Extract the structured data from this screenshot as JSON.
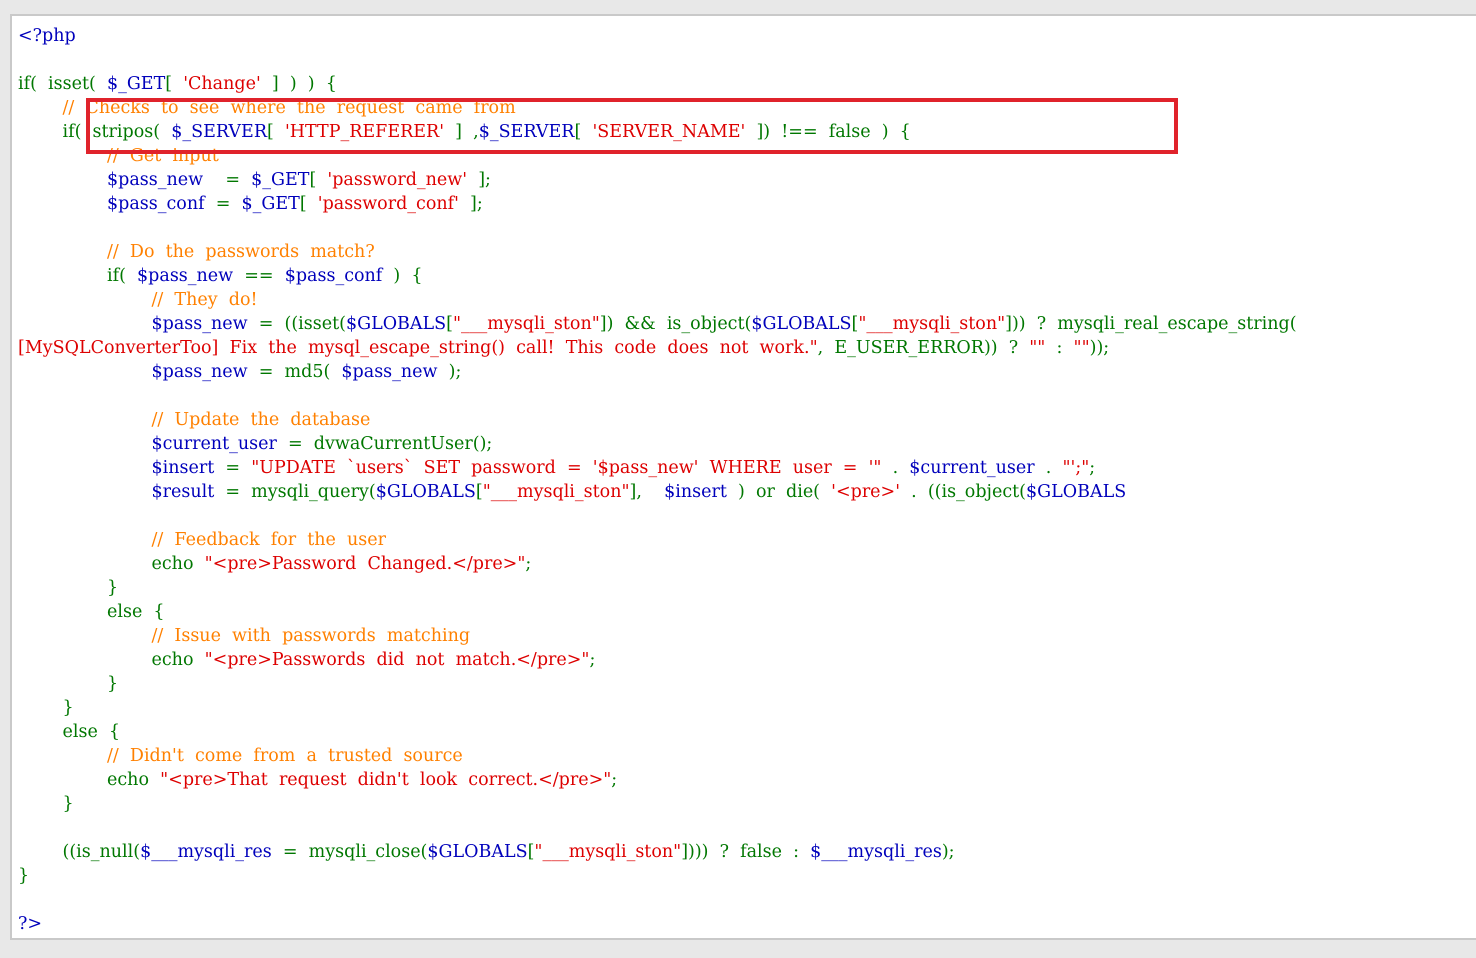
{
  "code_lines": [
    [
      {
        "c": "t",
        "x": "<?php"
      }
    ],
    [],
    [
      {
        "c": "k",
        "x": "if(  isset(  "
      },
      {
        "c": "v",
        "x": "$_GET"
      },
      {
        "c": "k",
        "x": "[  "
      },
      {
        "c": "s",
        "x": "'Change'"
      },
      {
        "c": "k",
        "x": "  ]  )  )  {"
      }
    ],
    [
      {
        "c": "p",
        "x": "        "
      },
      {
        "c": "c",
        "x": "//  Checks  to  see  where  the  request  came  from"
      }
    ],
    [
      {
        "c": "p",
        "x": "        "
      },
      {
        "c": "k",
        "x": "if(  stripos(  "
      },
      {
        "c": "v",
        "x": "$_SERVER"
      },
      {
        "c": "k",
        "x": "[  "
      },
      {
        "c": "s",
        "x": "'HTTP_REFERER'"
      },
      {
        "c": "k",
        "x": "  ]  ,"
      },
      {
        "c": "v",
        "x": "$_SERVER"
      },
      {
        "c": "k",
        "x": "[  "
      },
      {
        "c": "s",
        "x": "'SERVER_NAME'"
      },
      {
        "c": "k",
        "x": "  ])  !==  false  )  {"
      }
    ],
    [
      {
        "c": "p",
        "x": "                "
      },
      {
        "c": "c",
        "x": "//  Get  input"
      }
    ],
    [
      {
        "c": "p",
        "x": "                "
      },
      {
        "c": "v",
        "x": "$pass_new"
      },
      {
        "c": "k",
        "x": "    =  "
      },
      {
        "c": "v",
        "x": "$_GET"
      },
      {
        "c": "k",
        "x": "[  "
      },
      {
        "c": "s",
        "x": "'password_new'"
      },
      {
        "c": "k",
        "x": "  ];"
      }
    ],
    [
      {
        "c": "p",
        "x": "                "
      },
      {
        "c": "v",
        "x": "$pass_conf"
      },
      {
        "c": "k",
        "x": "  =  "
      },
      {
        "c": "v",
        "x": "$_GET"
      },
      {
        "c": "k",
        "x": "[  "
      },
      {
        "c": "s",
        "x": "'password_conf'"
      },
      {
        "c": "k",
        "x": "  ];"
      }
    ],
    [],
    [
      {
        "c": "p",
        "x": "                "
      },
      {
        "c": "c",
        "x": "//  Do  the  passwords  match?"
      }
    ],
    [
      {
        "c": "p",
        "x": "                "
      },
      {
        "c": "k",
        "x": "if(  "
      },
      {
        "c": "v",
        "x": "$pass_new"
      },
      {
        "c": "k",
        "x": "  ==  "
      },
      {
        "c": "v",
        "x": "$pass_conf"
      },
      {
        "c": "k",
        "x": "  )  {"
      }
    ],
    [
      {
        "c": "p",
        "x": "                        "
      },
      {
        "c": "c",
        "x": "//  They  do!"
      }
    ],
    [
      {
        "c": "p",
        "x": "                        "
      },
      {
        "c": "v",
        "x": "$pass_new"
      },
      {
        "c": "k",
        "x": "  =  ((isset("
      },
      {
        "c": "v",
        "x": "$GLOBALS"
      },
      {
        "c": "k",
        "x": "["
      },
      {
        "c": "s",
        "x": "\"___mysqli_ston\""
      },
      {
        "c": "k",
        "x": "])  &&  is_object("
      },
      {
        "c": "v",
        "x": "$GLOBALS"
      },
      {
        "c": "k",
        "x": "["
      },
      {
        "c": "s",
        "x": "\"___mysqli_ston\""
      },
      {
        "c": "k",
        "x": "]))  ?  mysqli_real_escape_string("
      }
    ],
    [
      {
        "c": "s",
        "x": "[MySQLConverterToo]  Fix  the  mysql_escape_string()  call!  This  code  does  not  work.\""
      },
      {
        "c": "k",
        "x": ",  E_USER_ERROR))  ?  "
      },
      {
        "c": "s",
        "x": "\"\""
      },
      {
        "c": "k",
        "x": "  :  "
      },
      {
        "c": "s",
        "x": "\"\""
      },
      {
        "c": "k",
        "x": "));"
      }
    ],
    [
      {
        "c": "p",
        "x": "                        "
      },
      {
        "c": "v",
        "x": "$pass_new"
      },
      {
        "c": "k",
        "x": "  =  md5(  "
      },
      {
        "c": "v",
        "x": "$pass_new"
      },
      {
        "c": "k",
        "x": "  );"
      }
    ],
    [],
    [
      {
        "c": "p",
        "x": "                        "
      },
      {
        "c": "c",
        "x": "//  Update  the  database"
      }
    ],
    [
      {
        "c": "p",
        "x": "                        "
      },
      {
        "c": "v",
        "x": "$current_user"
      },
      {
        "c": "k",
        "x": "  =  dvwaCurrentUser();"
      }
    ],
    [
      {
        "c": "p",
        "x": "                        "
      },
      {
        "c": "v",
        "x": "$insert"
      },
      {
        "c": "k",
        "x": "  =  "
      },
      {
        "c": "s",
        "x": "\"UPDATE  `users`  SET  password  =  '$pass_new'  WHERE  user  =  '\""
      },
      {
        "c": "k",
        "x": "  .  "
      },
      {
        "c": "v",
        "x": "$current_user"
      },
      {
        "c": "k",
        "x": "  .  "
      },
      {
        "c": "s",
        "x": "\"';\""
      },
      {
        "c": "k",
        "x": ";"
      }
    ],
    [
      {
        "c": "p",
        "x": "                        "
      },
      {
        "c": "v",
        "x": "$result"
      },
      {
        "c": "k",
        "x": "  =  mysqli_query("
      },
      {
        "c": "v",
        "x": "$GLOBALS"
      },
      {
        "c": "k",
        "x": "["
      },
      {
        "c": "s",
        "x": "\"___mysqli_ston\""
      },
      {
        "c": "k",
        "x": "],    "
      },
      {
        "c": "v",
        "x": "$insert"
      },
      {
        "c": "k",
        "x": "  )  or  die(  "
      },
      {
        "c": "s",
        "x": "'<pre>'"
      },
      {
        "c": "k",
        "x": "  .  ((is_object("
      },
      {
        "c": "v",
        "x": "$GLOBALS"
      }
    ],
    [],
    [
      {
        "c": "p",
        "x": "                        "
      },
      {
        "c": "c",
        "x": "//  Feedback  for  the  user"
      }
    ],
    [
      {
        "c": "p",
        "x": "                        "
      },
      {
        "c": "k",
        "x": "echo  "
      },
      {
        "c": "s",
        "x": "\"<pre>Password  Changed.</pre>\""
      },
      {
        "c": "k",
        "x": ";"
      }
    ],
    [
      {
        "c": "p",
        "x": "                "
      },
      {
        "c": "k",
        "x": "}"
      }
    ],
    [
      {
        "c": "p",
        "x": "                "
      },
      {
        "c": "k",
        "x": "else  {"
      }
    ],
    [
      {
        "c": "p",
        "x": "                        "
      },
      {
        "c": "c",
        "x": "//  Issue  with  passwords  matching"
      }
    ],
    [
      {
        "c": "p",
        "x": "                        "
      },
      {
        "c": "k",
        "x": "echo  "
      },
      {
        "c": "s",
        "x": "\"<pre>Passwords  did  not  match.</pre>\""
      },
      {
        "c": "k",
        "x": ";"
      }
    ],
    [
      {
        "c": "p",
        "x": "                "
      },
      {
        "c": "k",
        "x": "}"
      }
    ],
    [
      {
        "c": "p",
        "x": "        "
      },
      {
        "c": "k",
        "x": "}"
      }
    ],
    [
      {
        "c": "p",
        "x": "        "
      },
      {
        "c": "k",
        "x": "else  {"
      }
    ],
    [
      {
        "c": "p",
        "x": "                "
      },
      {
        "c": "c",
        "x": "//  Didn't  come  from  a  trusted  source"
      }
    ],
    [
      {
        "c": "p",
        "x": "                "
      },
      {
        "c": "k",
        "x": "echo  "
      },
      {
        "c": "s",
        "x": "\"<pre>That  request  didn't  look  correct.</pre>\""
      },
      {
        "c": "k",
        "x": ";"
      }
    ],
    [
      {
        "c": "p",
        "x": "        "
      },
      {
        "c": "k",
        "x": "}"
      }
    ],
    [],
    [
      {
        "c": "p",
        "x": "        "
      },
      {
        "c": "k",
        "x": "((is_null("
      },
      {
        "c": "v",
        "x": "$___mysqli_res"
      },
      {
        "c": "k",
        "x": "  =  mysqli_close("
      },
      {
        "c": "v",
        "x": "$GLOBALS"
      },
      {
        "c": "k",
        "x": "["
      },
      {
        "c": "s",
        "x": "\"___mysqli_ston\""
      },
      {
        "c": "k",
        "x": "])))  ?  false  :  "
      },
      {
        "c": "v",
        "x": "$___mysqli_res"
      },
      {
        "c": "k",
        "x": ");"
      }
    ],
    [
      {
        "c": "k",
        "x": "}"
      }
    ],
    [],
    [
      {
        "c": "t",
        "x": "?>"
      }
    ]
  ],
  "highlight": {
    "color": "#e0232b",
    "target_lines": [
      3,
      4
    ]
  },
  "colors": {
    "keyword": "#007700",
    "variable": "#0000bb",
    "string": "#dd0000",
    "comment": "#ff8000",
    "tag": "#0000bb"
  }
}
